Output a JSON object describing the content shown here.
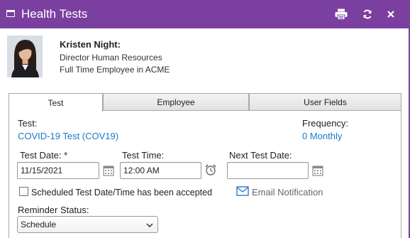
{
  "window": {
    "title": "Health Tests"
  },
  "employee": {
    "name": "Kristen Night:",
    "title": "Director Human Resources",
    "status": "Full Time Employee in ACME"
  },
  "tabs": [
    {
      "label": "Test",
      "active": true
    },
    {
      "label": "Employee",
      "active": false
    },
    {
      "label": "User Fields",
      "active": false
    }
  ],
  "form": {
    "test_label": "Test:",
    "test_value": "COVID-19 Test (COV19)",
    "frequency_label": "Frequency:",
    "frequency_value": "0 Monthly",
    "test_date_label": "Test Date: *",
    "test_date_value": "11/15/2021",
    "test_time_label": "Test Time:",
    "test_time_value": "12:00 AM",
    "next_test_date_label": "Next Test Date:",
    "next_test_date_value": "",
    "accepted_checkbox_label": "Scheduled Test Date/Time has been accepted",
    "accepted_checked": false,
    "email_notification_label": "Email Notification",
    "reminder_status_label": "Reminder Status:",
    "reminder_status_value": "Schedule"
  },
  "colors": {
    "titlebar": "#7b3fa0",
    "link": "#1a7ac7"
  },
  "icons": [
    "window-icon",
    "print-icon",
    "refresh-icon",
    "close-icon",
    "calendar-icon",
    "alarm-clock-icon",
    "mail-icon",
    "chevron-down-icon"
  ]
}
